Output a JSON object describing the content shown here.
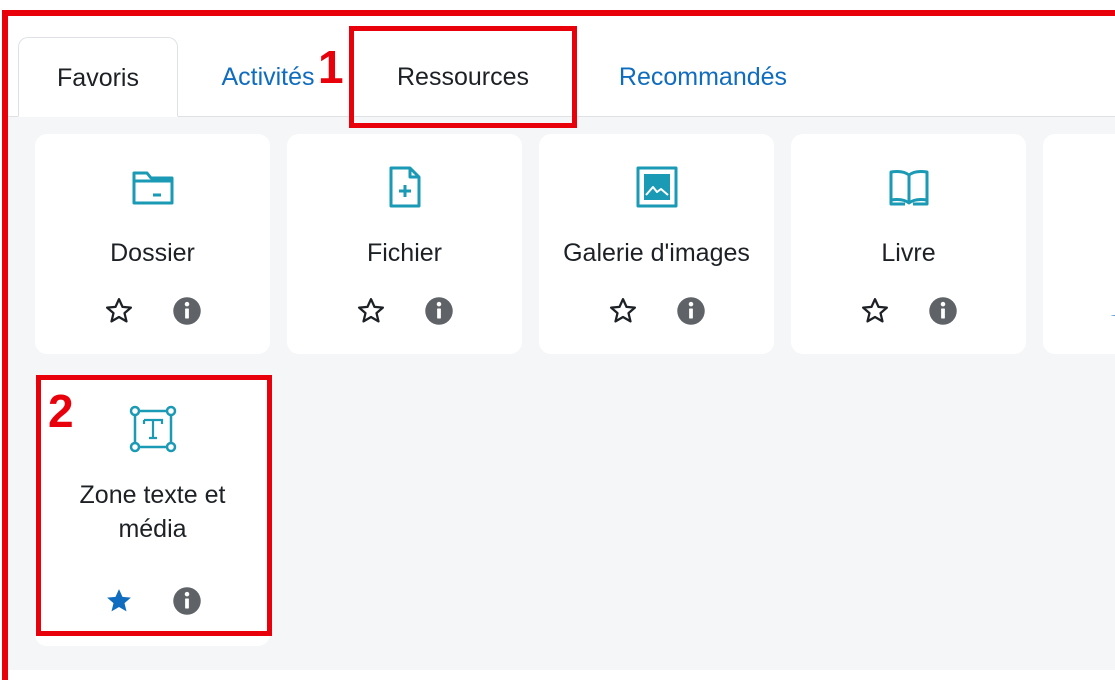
{
  "tabs": [
    {
      "label": "Favoris",
      "state": "active"
    },
    {
      "label": "Activités",
      "state": "link"
    },
    {
      "label": "Ressources",
      "state": "selected"
    },
    {
      "label": "Recommandés",
      "state": "link"
    }
  ],
  "resources": [
    {
      "name": "Dossier",
      "icon": "folder-icon",
      "starred": false
    },
    {
      "name": "Fichier",
      "icon": "file-plus-icon",
      "starred": false
    },
    {
      "name": "Galerie d'images",
      "icon": "image-gallery-icon",
      "starred": false
    },
    {
      "name": "Livre",
      "icon": "book-icon",
      "starred": false
    },
    {
      "name": "Zone texte et\nmédia",
      "icon": "text-area-icon",
      "starred": true
    }
  ],
  "annotations": [
    {
      "label": "1",
      "target": "Ressources tab"
    },
    {
      "label": "2",
      "target": "Zone texte et média card"
    }
  ],
  "colors": {
    "annotation": "#e8000b",
    "icon": "#1a9ab5",
    "link": "#0f6cbf",
    "star_filled": "#0f6cbf",
    "info_circle": "#5f6368"
  }
}
